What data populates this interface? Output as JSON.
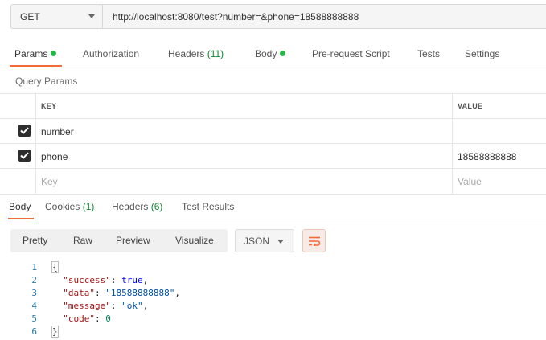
{
  "request": {
    "method": "GET",
    "url": "http://localhost:8080/test?number=&phone=18588888888"
  },
  "request_tabs": {
    "params": "Params",
    "authorization": "Authorization",
    "headers": "Headers",
    "headers_count": "(11)",
    "body": "Body",
    "prerequest": "Pre-request Script",
    "tests": "Tests",
    "settings": "Settings"
  },
  "query_params": {
    "title": "Query Params",
    "headers": {
      "key": "KEY",
      "value": "VALUE"
    },
    "rows": [
      {
        "checked": true,
        "key": "number",
        "value": ""
      },
      {
        "checked": true,
        "key": "phone",
        "value": "18588888888"
      }
    ],
    "placeholder": {
      "key": "Key",
      "value": "Value"
    }
  },
  "response_tabs": {
    "body": "Body",
    "cookies": "Cookies",
    "cookies_count": "(1)",
    "headers": "Headers",
    "headers_count": "(6)",
    "test_results": "Test Results"
  },
  "response_toolbar": {
    "pretty": "Pretty",
    "raw": "Raw",
    "preview": "Preview",
    "visualize": "Visualize",
    "format": "JSON"
  },
  "response_body": {
    "line_numbers": [
      "1",
      "2",
      "3",
      "4",
      "5",
      "6"
    ],
    "open_brace": "{",
    "close_brace": "}",
    "fields": [
      {
        "key": "\"success\"",
        "value": "true",
        "type": "bool",
        "comma": ","
      },
      {
        "key": "\"data\"",
        "value": "\"18588888888\"",
        "type": "string",
        "comma": ","
      },
      {
        "key": "\"message\"",
        "value": "\"ok\"",
        "type": "string",
        "comma": ","
      },
      {
        "key": "\"code\"",
        "value": "0",
        "type": "number",
        "comma": ""
      }
    ]
  },
  "colors": {
    "accent": "#f26b3a",
    "status_dot": "#26b547",
    "count_green": "#0e8a34"
  },
  "icons": {
    "method_dropdown": "chevron-down-icon",
    "wrap": "wrap-lines-icon",
    "checkbox": "checkbox-checked-icon"
  }
}
